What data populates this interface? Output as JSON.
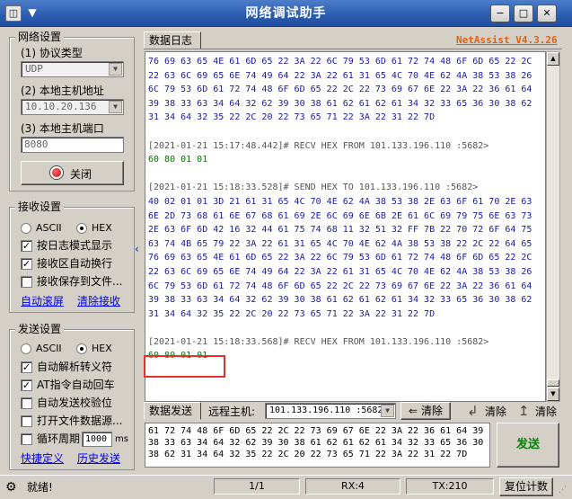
{
  "window": {
    "title": "网络调试助手",
    "brand": "NetAssist V4.3.26",
    "menu_arrow": "▼",
    "app_icon": "window-icon",
    "controls": {
      "minimize": "−",
      "maximize": "□",
      "close": "✕"
    }
  },
  "network": {
    "group_title": "网络设置",
    "protocol_label": "(1) 协议类型",
    "protocol_value": "UDP",
    "host_label": "(2) 本地主机地址",
    "host_value": "10.10.20.136",
    "port_label": "(3) 本地主机端口",
    "port_value": "8080",
    "close_button": "关闭"
  },
  "receive": {
    "group_title": "接收设置",
    "ascii_label": "ASCII",
    "hex_label": "HEX",
    "hex_selected": true,
    "opt_log": "按日志模式显示",
    "opt_log_checked": true,
    "opt_wrap": "接收区自动换行",
    "opt_wrap_checked": true,
    "opt_save": "接收保存到文件...",
    "opt_save_checked": false,
    "link_autoscroll": "自动滚屏",
    "link_clear": "清除接收"
  },
  "send": {
    "group_title": "发送设置",
    "ascii_label": "ASCII",
    "hex_label": "HEX",
    "hex_selected": true,
    "opt_escape": "自动解析转义符",
    "opt_escape_checked": true,
    "opt_at": "AT指令自动回车",
    "opt_at_checked": true,
    "opt_checksum": "自动发送校验位",
    "opt_checksum_checked": false,
    "opt_file": "打开文件数据源...",
    "opt_file_checked": false,
    "opt_loop": "循环周期",
    "opt_loop_checked": false,
    "loop_value": "1000",
    "loop_unit": "ms",
    "link_shortcut": "快捷定义",
    "link_history": "历史发送"
  },
  "log": {
    "tab_label": "数据日志",
    "lines": [
      {
        "text": "76 69 63 65 4E 61 6D 65 22 3A 22 6C 79 53 6D 61 72 74 48 6F 6D 65 22 2C",
        "cls": "hexblue"
      },
      {
        "text": "22 63 6C 69 65 6E 74 49 64 22 3A 22 61 31 65 4C 70 4E 62 4A 38 53 38 26",
        "cls": "hexblue"
      },
      {
        "text": "6C 79 53 6D 61 72 74 48 6F 6D 65 22 2C 22 73 69 67 6E 22 3A 22 36 61 64",
        "cls": "hexblue"
      },
      {
        "text": "39 38 33 63 34 64 32 62 39 30 38 61 62 61 62 61 34 32 33 65 36 30 38 62",
        "cls": "hexblue"
      },
      {
        "text": "31 34 64 32 35 22 2C 20 22 73 65 71 22 3A 22 31 22 7D",
        "cls": "hexblue"
      },
      {
        "text": "",
        "cls": "hexblue"
      },
      {
        "text": "[2021-01-21 15:17:48.442]# RECV HEX FROM 101.133.196.110 :5682>",
        "cls": "loggray"
      },
      {
        "text": "60 80 01 01",
        "cls": "hexgreen"
      },
      {
        "text": "",
        "cls": "hexblue"
      },
      {
        "text": "[2021-01-21 15:18:33.528]# SEND HEX TO 101.133.196.110 :5682>",
        "cls": "loggray"
      },
      {
        "text": "40 02 01 01 3D 21 61 31 65 4C 70 4E 62 4A 38 53 38 2E 63 6F 61 70 2E 63",
        "cls": "hexblue"
      },
      {
        "text": "6E 2D 73 68 61 6E 67 68 61 69 2E 6C 69 6E 6B 2E 61 6C 69 79 75 6E 63 73",
        "cls": "hexblue"
      },
      {
        "text": "2E 63 6F 6D 42 16 32 44 61 75 74 68 11 32 51 32 FF 7B 22 70 72 6F 64 75",
        "cls": "hexblue"
      },
      {
        "text": "63 74 4B 65 79 22 3A 22 61 31 65 4C 70 4E 62 4A 38 53 38 22 2C 22 64 65",
        "cls": "hexblue"
      },
      {
        "text": "76 69 63 65 4E 61 6D 65 22 3A 22 6C 79 53 6D 61 72 74 48 6F 6D 65 22 2C",
        "cls": "hexblue"
      },
      {
        "text": "22 63 6C 69 65 6E 74 49 64 22 3A 22 61 31 65 4C 70 4E 62 4A 38 53 38 26",
        "cls": "hexblue"
      },
      {
        "text": "6C 79 53 6D 61 72 74 48 6F 6D 65 22 2C 22 73 69 67 6E 22 3A 22 36 61 64",
        "cls": "hexblue"
      },
      {
        "text": "39 38 33 63 34 64 32 62 39 30 38 61 62 61 62 61 34 32 33 65 36 30 38 62",
        "cls": "hexblue"
      },
      {
        "text": "31 34 64 32 35 22 2C 20 22 73 65 71 22 3A 22 31 22 7D",
        "cls": "hexblue"
      },
      {
        "text": "",
        "cls": "hexblue"
      },
      {
        "text": "[2021-01-21 15:18:33.568]# RECV HEX FROM 101.133.196.110 :5682>",
        "cls": "loggray"
      },
      {
        "text": "60 80 01 01",
        "cls": "hexgreen"
      }
    ]
  },
  "send_panel": {
    "tab_label": "数据发送",
    "remote_label": "远程主机:",
    "remote_value": "101.133.196.110 :5682",
    "clear_label": "清除",
    "clear_label_2": "清除",
    "clear_label_3": "清除",
    "send_button": "发送",
    "content_lines": [
      "61 72 74 48 6F 6D 65 22 2C 22 73 69 67 6E 22 3A 22 36 61 64 39",
      "38 33 63 34 64 32 62 39 30 38 61 62 61 62 61 34 32 33 65 36 30",
      "38 62 31 34 64 32 35 22 2C 20 22 73 65 71 22 3A 22 31 22 7D"
    ]
  },
  "status": {
    "ready": "就绪!",
    "page": "1/1",
    "rx": "RX:4",
    "tx": "TX:210",
    "reset": "复位计数"
  }
}
